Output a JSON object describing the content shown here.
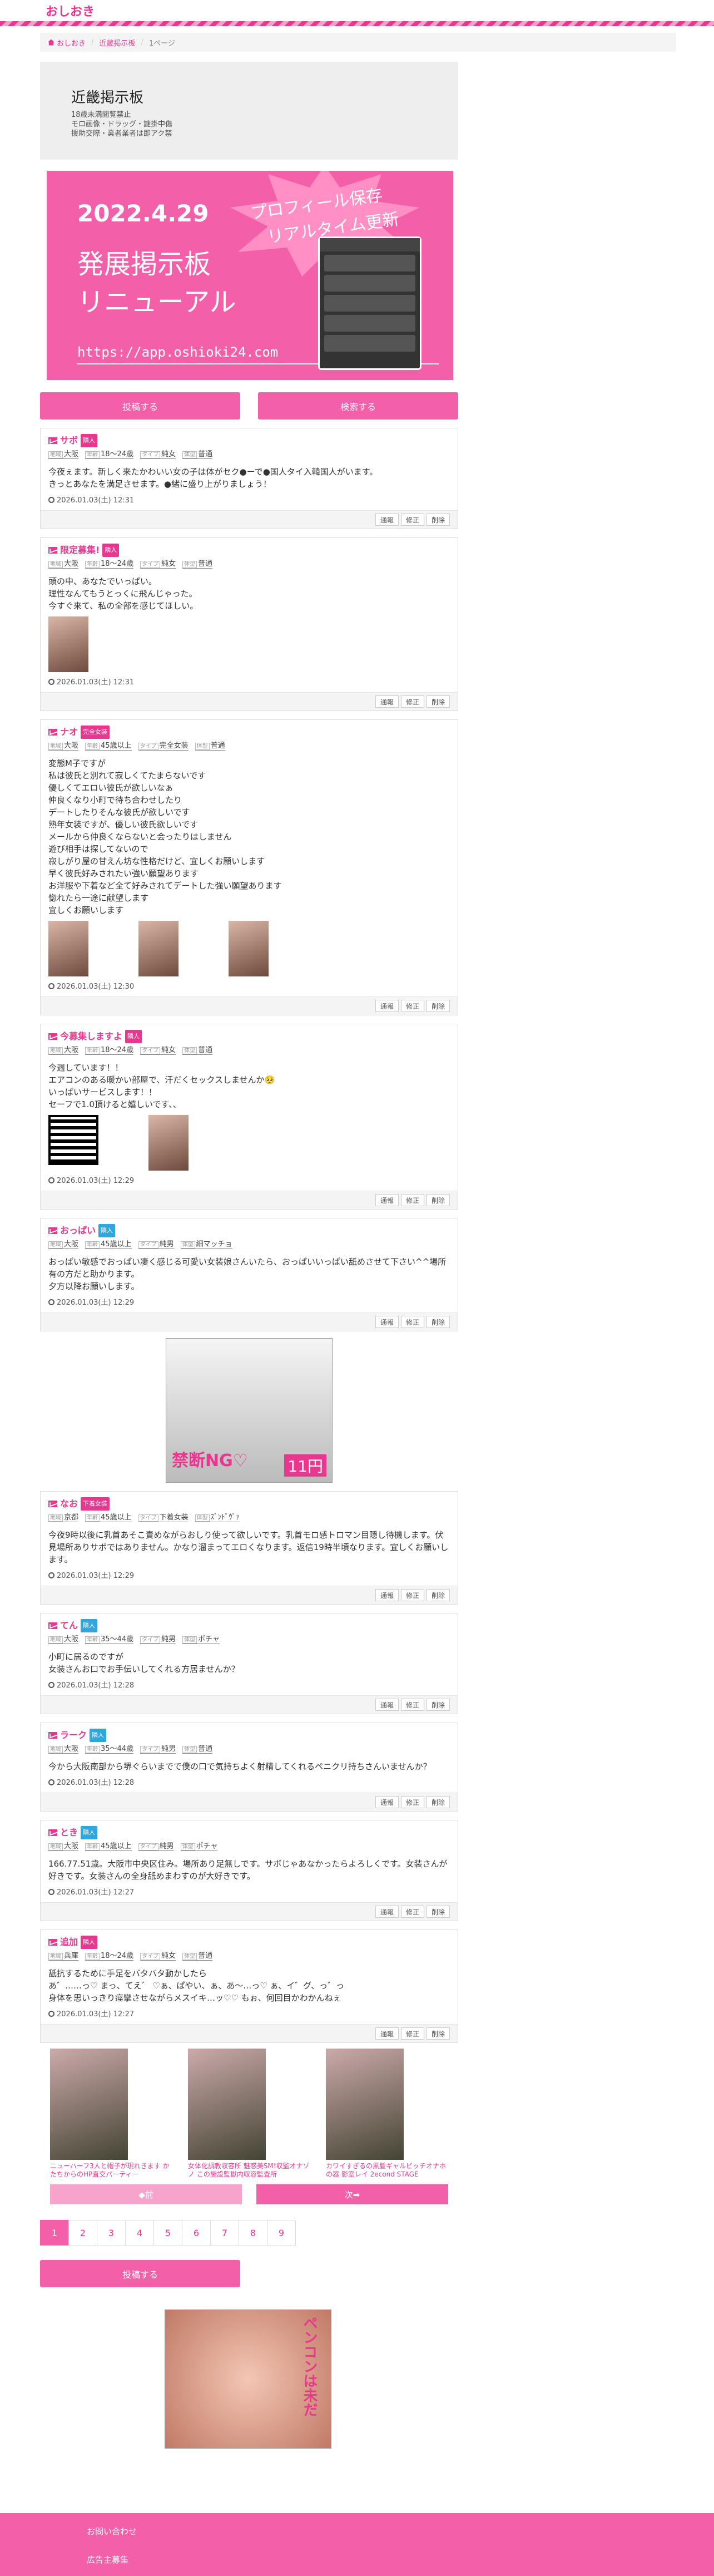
{
  "site": {
    "logo": "おしおき"
  },
  "breadcrumb": {
    "home": "おしおき",
    "board": "近畿掲示板",
    "page": "1ページ"
  },
  "board": {
    "title": "近畿掲示板",
    "lines": [
      "18歳未満閲覧禁止",
      "モロ画像・ドラッグ・謎掛中傷",
      "援助交際・業者業者は即アク禁"
    ]
  },
  "banner": {
    "date": "2022.4.29",
    "line1": "発展掲示板",
    "line2": "リニューアル",
    "badge1": "プロフィール保存",
    "badge2": "リアルタイム更新",
    "url": "https://app.oshioki24.com"
  },
  "buttons": {
    "post": "投稿する",
    "search": "検索する"
  },
  "labels": {
    "area": "地域",
    "age": "年齢",
    "type": "タイプ",
    "body": "体型"
  },
  "actions": [
    "通報",
    "修正",
    "削除"
  ],
  "posts": [
    {
      "name": "サボ",
      "tag": "隣人",
      "tag_color": "#e8378f",
      "area": "大阪",
      "age": "18〜24歳",
      "type": "純女",
      "body": "普通",
      "text": "今夜ぇます。新しく来たかわいい女の子は体がセク●ーで●国人タイ入韓国人がいます。\nきっとあなたを満足させます。●緒に盛り上がりましょう！",
      "time": "2026.01.03(土) 12:31",
      "images": 0,
      "qr": false
    },
    {
      "name": "限定募集!",
      "tag": "隣人",
      "tag_color": "#e8378f",
      "area": "大阪",
      "age": "18〜24歳",
      "type": "純女",
      "body": "普通",
      "text": "頭の中、あなたでいっぱい。\n理性なんてもうとっくに飛んじゃった。\n今すぐ来て、私の全部を感じてほしい。",
      "time": "2026.01.03(土) 12:31",
      "images": 1,
      "qr": false
    },
    {
      "name": "ナオ",
      "tag": "完全女装",
      "tag_color": "#e8378f",
      "area": "大阪",
      "age": "45歳以上",
      "type": "完全女装",
      "body": "普通",
      "text": "変態M子ですが\n私は彼氏と別れて寂しくてたまらないです\n優しくてエロい彼氏が欲しいなぁ\n仲良くなり小町で待ち合わせしたり\nデートしたりそんな彼氏が欲しいです\n熟年女装ですが、優しい彼氏欲しいです\nメールから仲良くならないと会ったりはしません\n遊び相手は探してないので\n寂しがり屋の甘えん坊な性格だけど、宜しくお願いします\n早く彼氏好みされたい強い願望あります\nお洋服や下着など全て好みされてデートした強い願望あります\n惚れたら一途に献望します\n宜しくお願いします",
      "time": "2026.01.03(土) 12:30",
      "images": 3,
      "qr": false
    },
    {
      "name": "今募集しますよ",
      "tag": "隣人",
      "tag_color": "#e8378f",
      "area": "大阪",
      "age": "18〜24歳",
      "type": "純女",
      "body": "普通",
      "text": "今週しています！！\nエアコンのある暖かい部屋で、汗だくセックスしませんか🥺\nいっぱいサービスします！！\nセーフで1.0頂けると嬉しいです、、",
      "time": "2026.01.03(土) 12:29",
      "images": 1,
      "qr": true
    },
    {
      "name": "おっぱい",
      "tag": "隣人",
      "tag_color": "#2fa6de",
      "area": "大阪",
      "age": "45歳以上",
      "type": "純男",
      "body": "細マッチョ",
      "text": "おっぱい敏感でおっぱい凄く感じる可愛い女装娘さんいたら、おっぱいいっぱい舐めさせて下さい^^場所有の方だと助かります。\n夕方以降お願いします。",
      "time": "2026.01.03(土) 12:29",
      "images": 0,
      "qr": false
    },
    {
      "name": "なお",
      "tag": "下着女装",
      "tag_color": "#e8378f",
      "area": "京都",
      "age": "45歳以上",
      "type": "下着女装",
      "body": "ｽﾞﾝﾄﾞｳﾞｧ",
      "text": "今夜9時以後に乳首あそこ責めながらおしり使って欲しいです。乳首モロ感トロマン目隠し待機します。伏見場所ありサポではありません。かなり溜まってエロくなります。返信19時半頃なります。宜しくお願いします。",
      "time": "2026.01.03(土) 12:29",
      "images": 0,
      "qr": false
    },
    {
      "name": "てん",
      "tag": "隣人",
      "tag_color": "#2fa6de",
      "area": "大阪",
      "age": "35〜44歳",
      "type": "純男",
      "body": "ポチャ",
      "text": "小町に居るのですが\n女装さんお口でお手伝いしてくれる方居ませんか？",
      "time": "2026.01.03(土) 12:28",
      "images": 0,
      "qr": false
    },
    {
      "name": "ラーク",
      "tag": "隣人",
      "tag_color": "#2fa6de",
      "area": "大阪",
      "age": "35〜44歳",
      "type": "純男",
      "body": "普通",
      "text": "今から大阪南部から堺ぐらいまでで僕の口で気持ちよく射精してくれるペニクリ持ちさんいませんか？",
      "time": "2026.01.03(土) 12:28",
      "images": 0,
      "qr": false
    },
    {
      "name": "とき",
      "tag": "隣人",
      "tag_color": "#2fa6de",
      "area": "大阪",
      "age": "45歳以上",
      "type": "純男",
      "body": "ポチャ",
      "text": "166.77.51歳。大阪市中央区住み。場所あり足無しです。サボじゃあなかったらよろしくです。女装さんが好きです。女装さんの全身舐めまわすのが大好きです。",
      "time": "2026.01.03(土) 12:27",
      "images": 0,
      "qr": false
    },
    {
      "name": "追加",
      "tag": "隣人",
      "tag_color": "#e8378f",
      "area": "兵庫",
      "age": "18〜24歳",
      "type": "純女",
      "body": "普通",
      "text": "舐抗するために手足をバタバタ動かしたら\nあ゛……っ♡ まっ、てえ゛ ♡ぁ、ぱやい、ぁ、あ〜…っ♡ ぁ、イ゛グ、っ゛っ\n身体を思いっきり痙攣させながらメスイキ…ッ♡♡ もぉ、何回目かわかんねぇ",
      "time": "2026.01.03(土) 12:27",
      "images": 0,
      "qr": false
    }
  ],
  "ad1": {
    "text": "禁断NG♡",
    "price": "11円"
  },
  "recommend": [
    {
      "caption": "ニューハーフ3人と帽子が現れきます かたちからのHP直交パーティー"
    },
    {
      "caption": "女体化調教収容所 魅惑美SM!収監オナゾノ この施設監獄内収容監査所"
    },
    {
      "caption": "カワイすぎるの黒髪ギャルビッチオナホの器 影室レイ 2econd STAGE"
    }
  ],
  "nav": {
    "prev": "◆前",
    "next": "次➡"
  },
  "pager": [
    "1",
    "2",
    "3",
    "4",
    "5",
    "6",
    "7",
    "8",
    "9"
  ],
  "ad2": {
    "text": "ペンコンは未だ"
  },
  "footer": {
    "contact": "お問い合わせ",
    "ads": "広告主募集"
  }
}
